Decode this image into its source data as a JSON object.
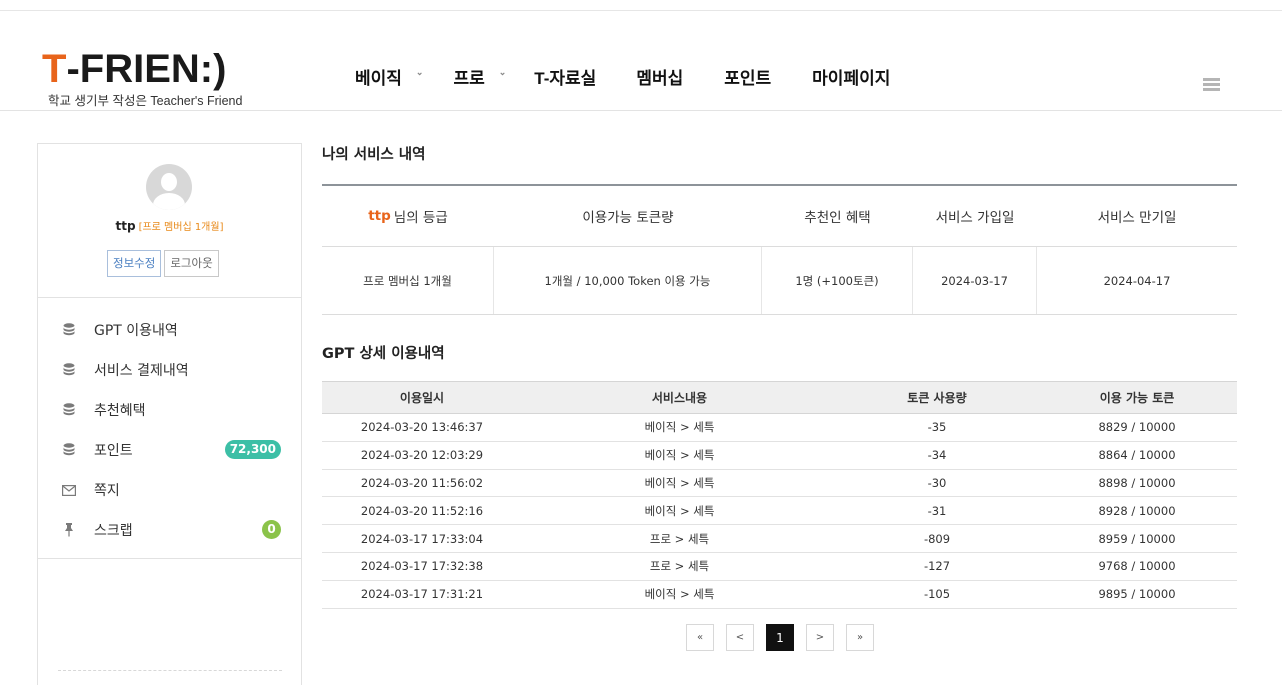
{
  "header": {
    "logo": {
      "text_t": "T",
      "text_rest": "-FRIEN:)",
      "tagline": "학교 생기부 작성은 Teacher's Friend"
    },
    "nav": [
      {
        "label": "베이직",
        "has_dropdown": true
      },
      {
        "label": "프로",
        "has_dropdown": true
      },
      {
        "label": "T-자료실",
        "has_dropdown": false
      },
      {
        "label": "멤버십",
        "has_dropdown": false
      },
      {
        "label": "포인트",
        "has_dropdown": false
      },
      {
        "label": "마이페이지",
        "has_dropdown": false
      }
    ],
    "menu_icon": "hamburger-icon"
  },
  "sidebar": {
    "profile": {
      "user_id": "ttp",
      "grade": "[프로 멤버십 1개월]",
      "edit_label": "정보수정",
      "logout_label": "로그아웃"
    },
    "menu": [
      {
        "label": "GPT 이용내역",
        "icon": "database-icon"
      },
      {
        "label": "서비스 결제내역",
        "icon": "database-icon"
      },
      {
        "label": "추천혜택",
        "icon": "database-icon"
      },
      {
        "label": "포인트",
        "icon": "database-icon",
        "badge": "72,300",
        "badge_color": "#3cbfa6"
      },
      {
        "label": "쪽지",
        "icon": "envelope-icon"
      },
      {
        "label": "스크랩",
        "icon": "pin-icon",
        "badge": "0",
        "badge_color": "#8bc34a"
      }
    ]
  },
  "service": {
    "title": "나의 서비스 내역",
    "headers": {
      "grade_user": "ttp",
      "grade_suffix": "님의 등급",
      "tokens": "이용가능 토큰량",
      "referral": "추천인 혜택",
      "join_date": "서비스 가입일",
      "expire_date": "서비스 만기일"
    },
    "row": {
      "grade": "프로 멤버십 1개월",
      "tokens": "1개월 / 10,000 Token 이용 가능",
      "referral": "1명 (+100토큰)",
      "join_date": "2024-03-17",
      "expire_date": "2024-04-17"
    }
  },
  "gpt": {
    "title": "GPT 상세 이용내역",
    "columns": [
      "이용일시",
      "서비스내용",
      "토큰 사용량",
      "이용 가능 토큰"
    ],
    "rows": [
      [
        "2024-03-20 13:46:37",
        "베이직 > 세특",
        "-35",
        "8829 / 10000"
      ],
      [
        "2024-03-20 12:03:29",
        "베이직 > 세특",
        "-34",
        "8864 / 10000"
      ],
      [
        "2024-03-20 11:56:02",
        "베이직 > 세특",
        "-30",
        "8898 / 10000"
      ],
      [
        "2024-03-20 11:52:16",
        "베이직 > 세특",
        "-31",
        "8928 / 10000"
      ],
      [
        "2024-03-17 17:33:04",
        "프로 > 세특",
        "-809",
        "8959 / 10000"
      ],
      [
        "2024-03-17 17:32:38",
        "프로 > 세특",
        "-127",
        "9768 / 10000"
      ],
      [
        "2024-03-17 17:31:21",
        "베이직 > 세특",
        "-105",
        "9895 / 10000"
      ]
    ]
  },
  "pagination": {
    "first": "«",
    "prev": "<",
    "current": "1",
    "next": ">",
    "last": "»"
  },
  "colors": {
    "accent_orange": "#e8641b",
    "grade_orange": "#e88a1a",
    "point_badge": "#3cbfa6",
    "scrap_badge": "#8bc34a"
  }
}
